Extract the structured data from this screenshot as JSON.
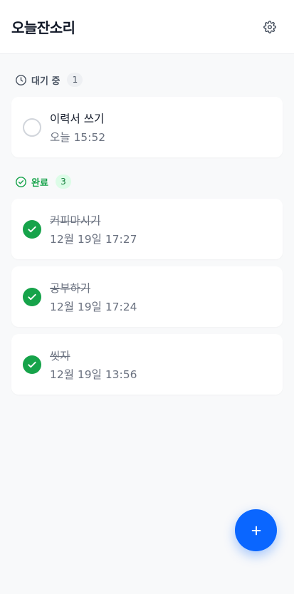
{
  "app": {
    "title": "오늘잔소리"
  },
  "header": {
    "settings_icon": "gear-icon"
  },
  "pending": {
    "label": "대기 중",
    "count": "1",
    "icon": "clock-icon",
    "items": [
      {
        "title": "이력서 쓰기",
        "time": "오늘 15:52",
        "completed": false
      }
    ]
  },
  "done": {
    "label": "완료",
    "count": "3",
    "icon": "check-circle-icon",
    "items": [
      {
        "title": "커피마시기",
        "time": "12월 19일 17:27",
        "completed": true
      },
      {
        "title": "공부하기",
        "time": "12월 19일 17:24",
        "completed": true
      },
      {
        "title": "씻자",
        "time": "12월 19일 13:56",
        "completed": true
      }
    ]
  },
  "fab": {
    "icon": "plus-icon"
  },
  "colors": {
    "accent": "#0a66ff",
    "success": "#16a34a",
    "background": "#f8f9fa"
  }
}
